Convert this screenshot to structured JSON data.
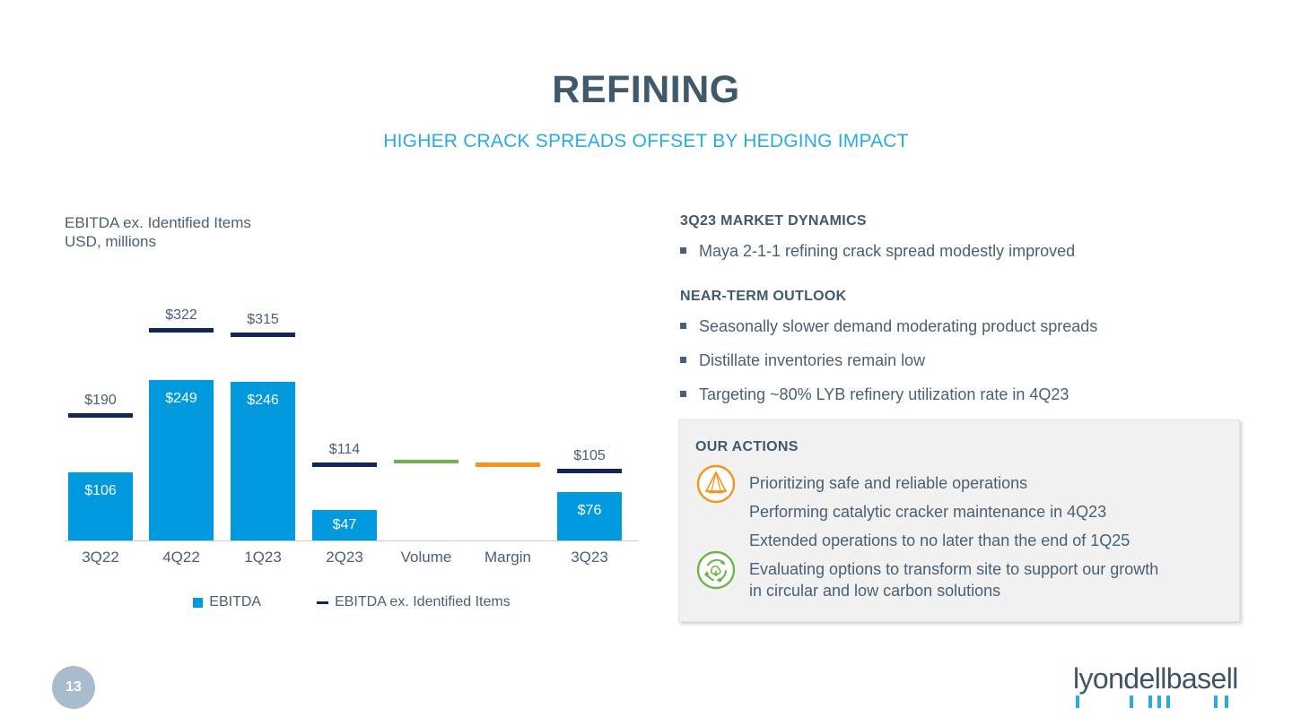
{
  "slide": {
    "title": "REFINING",
    "subtitle": "HIGHER CRACK SPREADS OFFSET BY HEDGING IMPACT",
    "page_number": "13"
  },
  "brand": {
    "wordmark": "lyondellbasell"
  },
  "chart_data": {
    "type": "bar",
    "title": "EBITDA ex. Identified Items\nUSD, millions",
    "xlabel": "",
    "ylabel": "USD, millions",
    "ylim": [
      0,
      340
    ],
    "grid": false,
    "legend_position": "bottom",
    "categories": [
      "3Q22",
      "4Q22",
      "1Q23",
      "2Q23",
      "Volume",
      "Margin",
      "3Q23"
    ],
    "series": [
      {
        "name": "EBITDA",
        "type": "bar",
        "color": "#0099dd",
        "values": [
          106,
          249,
          246,
          47,
          null,
          null,
          76
        ],
        "labels": [
          "$106",
          "$249",
          "$246",
          "$47",
          "",
          "",
          "$76"
        ]
      },
      {
        "name": "EBITDA ex. Identified Items",
        "type": "marker",
        "color": "#12265a",
        "values": [
          190,
          322,
          315,
          114,
          null,
          null,
          105
        ],
        "labels": [
          "$190",
          "$322",
          "$315",
          "$114",
          "",
          "",
          "$105"
        ]
      }
    ],
    "bridge_markers": [
      {
        "category": "Volume",
        "color": "#6fb44a",
        "value": 120,
        "label": ""
      },
      {
        "category": "Margin",
        "color": "#f7941e",
        "value": 115,
        "label": ""
      }
    ],
    "legend": [
      {
        "label": "EBITDA",
        "marker": "square",
        "color": "#0099dd"
      },
      {
        "label": "EBITDA ex. Identified Items",
        "marker": "dash",
        "color": "#12265a"
      }
    ]
  },
  "market_dynamics": {
    "heading": "3Q23 MARKET DYNAMICS",
    "bullets": [
      "Maya 2-1-1 refining crack spread modestly improved"
    ]
  },
  "near_term_outlook": {
    "heading": "NEAR-TERM OUTLOOK",
    "bullets": [
      "Seasonally slower demand moderating product spreads",
      "Distillate inventories remain low",
      "Targeting ~80% LYB refinery utilization rate in 4Q23"
    ]
  },
  "our_actions": {
    "heading": "OUR ACTIONS",
    "items": [
      {
        "icon": "safety-pyramid-icon",
        "icon_color": "#f7941e",
        "text": "Prioritizing safe and reliable operations"
      },
      {
        "icon": "none",
        "icon_color": "",
        "text": "Performing catalytic cracker maintenance in 4Q23"
      },
      {
        "icon": "none",
        "icon_color": "",
        "text": "Extended operations to no later than the end of 1Q25"
      },
      {
        "icon": "circular-recycling-icon",
        "icon_color": "#6fb44a",
        "text": "Evaluating options to transform site to support our growth\nin circular and low carbon solutions"
      }
    ]
  },
  "colors": {
    "title": "#40596b",
    "subtitle": "#29abe2",
    "bar": "#0099dd",
    "marker": "#12265a",
    "volume": "#6fb44a",
    "margin": "#f7941e",
    "body_text": "#4a6074",
    "box_bg": "#f1f1f1"
  }
}
